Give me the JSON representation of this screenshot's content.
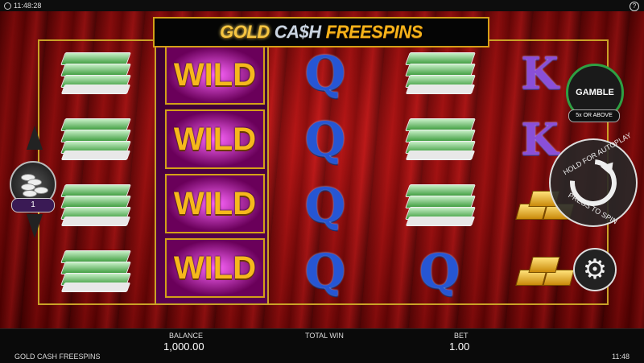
{
  "topbar": {
    "time": "11:48:28",
    "help_icon": "?"
  },
  "logo": {
    "gold": "GOLD",
    "cash": "CA$H",
    "freespins": "FREESPINS"
  },
  "reels": {
    "col1": [
      "money",
      "money",
      "money",
      "money"
    ],
    "col2": [
      "WILD",
      "WILD",
      "WILD",
      "WILD"
    ],
    "col3": [
      "Q",
      "Q",
      "Q",
      "Q"
    ],
    "col4": [
      "money",
      "money",
      "money",
      "Q"
    ],
    "col5": [
      "K",
      "K",
      "gold",
      "gold"
    ]
  },
  "bet_control": {
    "level": "1"
  },
  "gamble": {
    "label": "GAMBLE",
    "note": "5x OR ABOVE"
  },
  "spin": {
    "hold_text": "HOLD FOR AUTOPLAY",
    "press_text": "PRESS TO SPIN"
  },
  "footer": {
    "balance_label": "BALANCE",
    "balance_value": "1,000.00",
    "total_win_label": "TOTAL WIN",
    "total_win_value": "",
    "bet_label": "BET",
    "bet_value": "1.00",
    "game_name": "GOLD CASH FREESPINS",
    "clock": "11:48"
  }
}
